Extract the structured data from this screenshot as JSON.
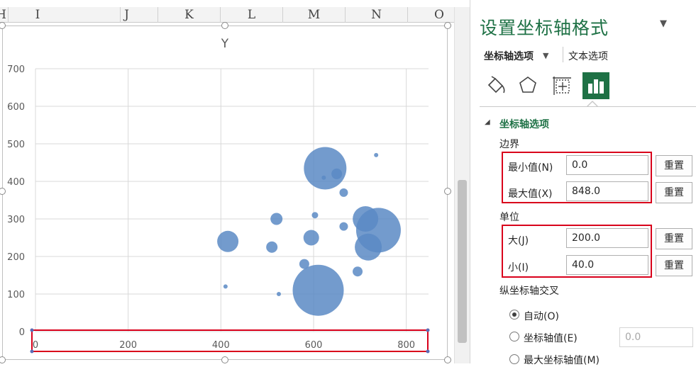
{
  "columns": [
    "H",
    "I",
    "J",
    "K",
    "L",
    "M",
    "N",
    "O"
  ],
  "colors": {
    "bubble": "#5b8ac4",
    "accent": "#1e7145",
    "highlight": "#d9001b"
  },
  "chart_data": {
    "type": "bubble",
    "title": "Y",
    "xlim": [
      0,
      848
    ],
    "ylim": [
      0,
      700
    ],
    "x_ticks": [
      "0",
      "200",
      "400",
      "600",
      "800"
    ],
    "y_ticks": [
      "0",
      "100",
      "200",
      "300",
      "400",
      "500",
      "600",
      "700"
    ],
    "grid": true,
    "points": [
      {
        "x": 625,
        "y": 435,
        "size": 60
      },
      {
        "x": 610,
        "y": 110,
        "size": 72
      },
      {
        "x": 740,
        "y": 270,
        "size": 63
      },
      {
        "x": 712,
        "y": 300,
        "size": 36
      },
      {
        "x": 718,
        "y": 225,
        "size": 38
      },
      {
        "x": 415,
        "y": 240,
        "size": 30
      },
      {
        "x": 595,
        "y": 250,
        "size": 22
      },
      {
        "x": 520,
        "y": 300,
        "size": 17
      },
      {
        "x": 510,
        "y": 225,
        "size": 16
      },
      {
        "x": 650,
        "y": 420,
        "size": 15
      },
      {
        "x": 665,
        "y": 370,
        "size": 12
      },
      {
        "x": 580,
        "y": 180,
        "size": 14
      },
      {
        "x": 695,
        "y": 160,
        "size": 14
      },
      {
        "x": 665,
        "y": 280,
        "size": 12
      },
      {
        "x": 603,
        "y": 310,
        "size": 9
      },
      {
        "x": 735,
        "y": 470,
        "size": 6
      },
      {
        "x": 622,
        "y": 410,
        "size": 6
      },
      {
        "x": 410,
        "y": 120,
        "size": 6
      },
      {
        "x": 525,
        "y": 100,
        "size": 6
      }
    ]
  },
  "pane": {
    "title": "设置坐标轴格式",
    "dropdown_glyph": "▼",
    "tab_axis_options": "坐标轴选项",
    "tab_text_options": "文本选项",
    "section_title": "坐标轴选项",
    "bounds_label": "边界",
    "min_label": "最小值(N)",
    "min_value": "0.0",
    "max_label": "最大值(X)",
    "max_value": "848.0",
    "units_label": "单位",
    "major_label": "大(J)",
    "major_value": "200.0",
    "minor_label": "小(I)",
    "minor_value": "40.0",
    "reset_label": "重置",
    "cross_label": "纵坐标轴交叉",
    "radio_auto": "自动(O)",
    "radio_axis_value": "坐标轴值(E)",
    "axis_value": "0.0",
    "radio_max": "最大坐标轴值(M)"
  }
}
